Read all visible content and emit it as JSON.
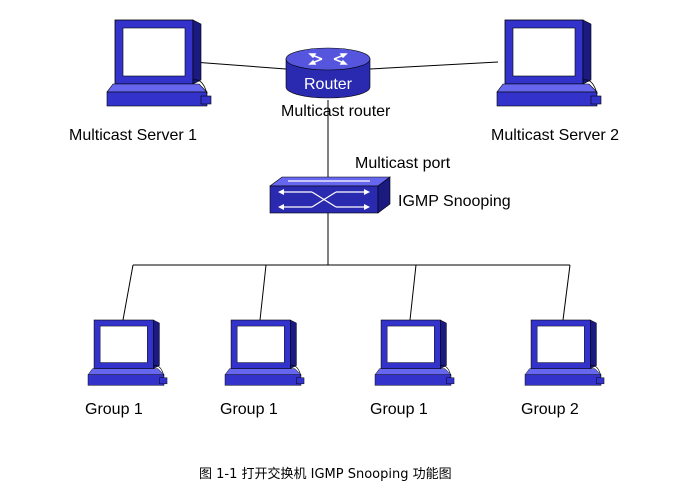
{
  "colors": {
    "device_fill": "#3333cc",
    "device_dark": "#1a1a80",
    "device_light": "#6666ee",
    "screen_fill": "#ffffff",
    "line": "#000000"
  },
  "icons": {
    "computer": "computer-icon",
    "router": "router-icon",
    "switch": "switch-icon"
  },
  "router": {
    "icon_text": "Router",
    "label": "Multicast router"
  },
  "servers": [
    {
      "label": "Multicast Server 1"
    },
    {
      "label": "Multicast Server 2"
    }
  ],
  "switch": {
    "port_label": "Multicast port",
    "label": "IGMP Snooping"
  },
  "groups": [
    {
      "label": "Group 1"
    },
    {
      "label": "Group 1"
    },
    {
      "label": "Group 1"
    },
    {
      "label": "Group 2"
    }
  ],
  "caption": "图 1-1 打开交换机 IGMP Snooping 功能图"
}
